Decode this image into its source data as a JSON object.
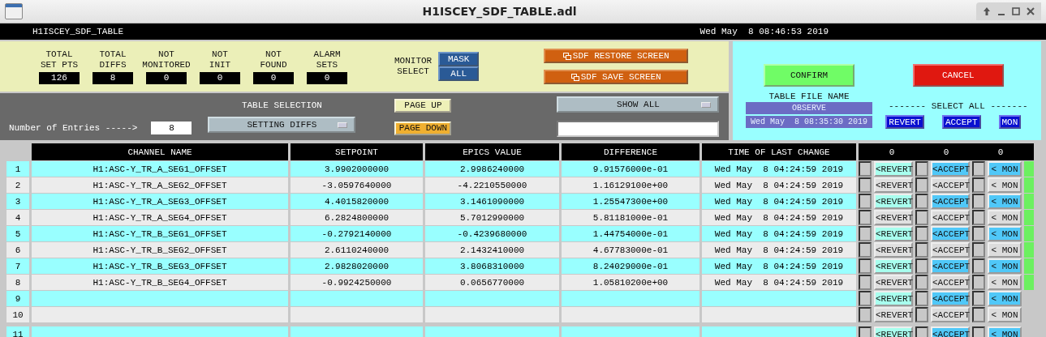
{
  "window": {
    "title": "H1ISCEY_SDF_TABLE.adl"
  },
  "header": {
    "name": "H1ISCEY_SDF_TABLE",
    "time": "Wed May  8 08:46:53 2019"
  },
  "counters": [
    {
      "label": "TOTAL\nSET PTS",
      "value": "126"
    },
    {
      "label": "TOTAL\nDIFFS",
      "value": "8"
    },
    {
      "label": "NOT\nMONITORED",
      "value": "0"
    },
    {
      "label": "NOT\nINIT",
      "value": "0"
    },
    {
      "label": "NOT\nFOUND",
      "value": "0"
    },
    {
      "label": "ALARM\nSETS",
      "value": "0"
    }
  ],
  "monitor_select": {
    "label": "MONITOR\nSELECT",
    "options": [
      "MASK",
      "ALL"
    ]
  },
  "screen_buttons": [
    "SDF RESTORE SCREEN",
    "SDF SAVE SCREEN"
  ],
  "entries": {
    "label": "Number of Entries ----->",
    "value": "8"
  },
  "table_selection": {
    "label": "TABLE SELECTION",
    "value": "SETTING DIFFS"
  },
  "page_buttons": [
    {
      "label": "PAGE UP",
      "color": "#eef0b8"
    },
    {
      "label": "PAGE DOWN",
      "color": "#f0b030"
    }
  ],
  "show_menu": {
    "value": "SHOW ALL"
  },
  "confirm": "CONFIRM",
  "cancel": "CANCEL",
  "table_file": {
    "label": "TABLE FILE NAME",
    "name": "OBSERVE",
    "time": "Wed May  8 08:35:30 2019"
  },
  "select_all": {
    "label": "------- SELECT ALL -------",
    "buttons": [
      "REVERT",
      "ACCEPT",
      "MON"
    ]
  },
  "table": {
    "columns": [
      "CHANNEL NAME",
      "SETPOINT",
      "EPICS VALUE",
      "DIFFERENCE",
      "TIME OF LAST CHANGE"
    ],
    "counts": [
      "0",
      "0",
      "0"
    ],
    "rows": [
      {
        "number": "1",
        "channel": "H1:ASC-Y_TR_A_SEG1_OFFSET",
        "setpoint": "3.9902000000",
        "epics": "2.9986240000",
        "difference": "9.91576000e-01",
        "time": "Wed May  8 04:24:59 2019",
        "actions": [
          {
            "label": "<REVERT",
            "checked": false
          },
          {
            "label": "<ACCEPT",
            "checked": false
          },
          {
            "label": "< MON",
            "checked": false
          }
        ],
        "indicator": true
      },
      {
        "number": "2",
        "channel": "H1:ASC-Y_TR_A_SEG2_OFFSET",
        "setpoint": "-3.0597640000",
        "epics": "-4.2210550000",
        "difference": "1.16129100e+00",
        "time": "Wed May  8 04:24:59 2019",
        "actions": [
          {
            "label": "<REVERT",
            "checked": false
          },
          {
            "label": "<ACCEPT",
            "checked": false
          },
          {
            "label": "< MON",
            "checked": false
          }
        ],
        "indicator": true
      },
      {
        "number": "3",
        "channel": "H1:ASC-Y_TR_A_SEG3_OFFSET",
        "setpoint": "4.4015820000",
        "epics": "3.1461090000",
        "difference": "1.25547300e+00",
        "time": "Wed May  8 04:24:59 2019",
        "actions": [
          {
            "label": "<REVERT",
            "checked": false
          },
          {
            "label": "<ACCEPT",
            "checked": false
          },
          {
            "label": "< MON",
            "checked": false
          }
        ],
        "indicator": true
      },
      {
        "number": "4",
        "channel": "H1:ASC-Y_TR_A_SEG4_OFFSET",
        "setpoint": "6.2824800000",
        "epics": "5.7012990000",
        "difference": "5.81181000e-01",
        "time": "Wed May  8 04:24:59 2019",
        "actions": [
          {
            "label": "<REVERT",
            "checked": false
          },
          {
            "label": "<ACCEPT",
            "checked": false
          },
          {
            "label": "< MON",
            "checked": false
          }
        ],
        "indicator": true
      },
      {
        "number": "5",
        "channel": "H1:ASC-Y_TR_B_SEG1_OFFSET",
        "setpoint": "-0.2792140000",
        "epics": "-0.4239680000",
        "difference": "1.44754000e-01",
        "time": "Wed May  8 04:24:59 2019",
        "actions": [
          {
            "label": "<REVERT",
            "checked": false
          },
          {
            "label": "<ACCEPT",
            "checked": false
          },
          {
            "label": "< MON",
            "checked": false
          }
        ],
        "indicator": true
      },
      {
        "number": "6",
        "channel": "H1:ASC-Y_TR_B_SEG2_OFFSET",
        "setpoint": "2.6110240000",
        "epics": "2.1432410000",
        "difference": "4.67783000e-01",
        "time": "Wed May  8 04:24:59 2019",
        "actions": [
          {
            "label": "<REVERT",
            "checked": false
          },
          {
            "label": "<ACCEPT",
            "checked": false
          },
          {
            "label": "< MON",
            "checked": false
          }
        ],
        "indicator": true
      },
      {
        "number": "7",
        "channel": "H1:ASC-Y_TR_B_SEG3_OFFSET",
        "setpoint": "2.9828020000",
        "epics": "3.8068310000",
        "difference": "8.24029000e-01",
        "time": "Wed May  8 04:24:59 2019",
        "actions": [
          {
            "label": "<REVERT",
            "checked": false
          },
          {
            "label": "<ACCEPT",
            "checked": false
          },
          {
            "label": "< MON",
            "checked": false
          }
        ],
        "indicator": true
      },
      {
        "number": "8",
        "channel": "H1:ASC-Y_TR_B_SEG4_OFFSET",
        "setpoint": "-0.9924250000",
        "epics": "0.0656770000",
        "difference": "1.05810200e+00",
        "time": "Wed May  8 04:24:59 2019",
        "actions": [
          {
            "label": "<REVERT",
            "checked": false
          },
          {
            "label": "<ACCEPT",
            "checked": false
          },
          {
            "label": "< MON",
            "checked": false
          }
        ],
        "indicator": true
      },
      {
        "number": "9",
        "actions": [
          {
            "label": "<REVERT",
            "checked": false
          },
          {
            "label": "<ACCEPT",
            "checked": false
          },
          {
            "label": "< MON",
            "checked": false
          }
        ],
        "indicator": false
      },
      {
        "number": "10",
        "actions": [
          {
            "label": "<REVERT",
            "checked": false
          },
          {
            "label": "<ACCEPT",
            "checked": false
          },
          {
            "label": "< MON",
            "checked": false
          }
        ],
        "indicator": false
      },
      {
        "number": "11",
        "actions": [
          {
            "label": "<REVERT",
            "checked": false
          },
          {
            "label": "<ACCEPT",
            "checked": false
          },
          {
            "label": "< MON",
            "checked": false
          }
        ],
        "indicator": false
      }
    ]
  }
}
